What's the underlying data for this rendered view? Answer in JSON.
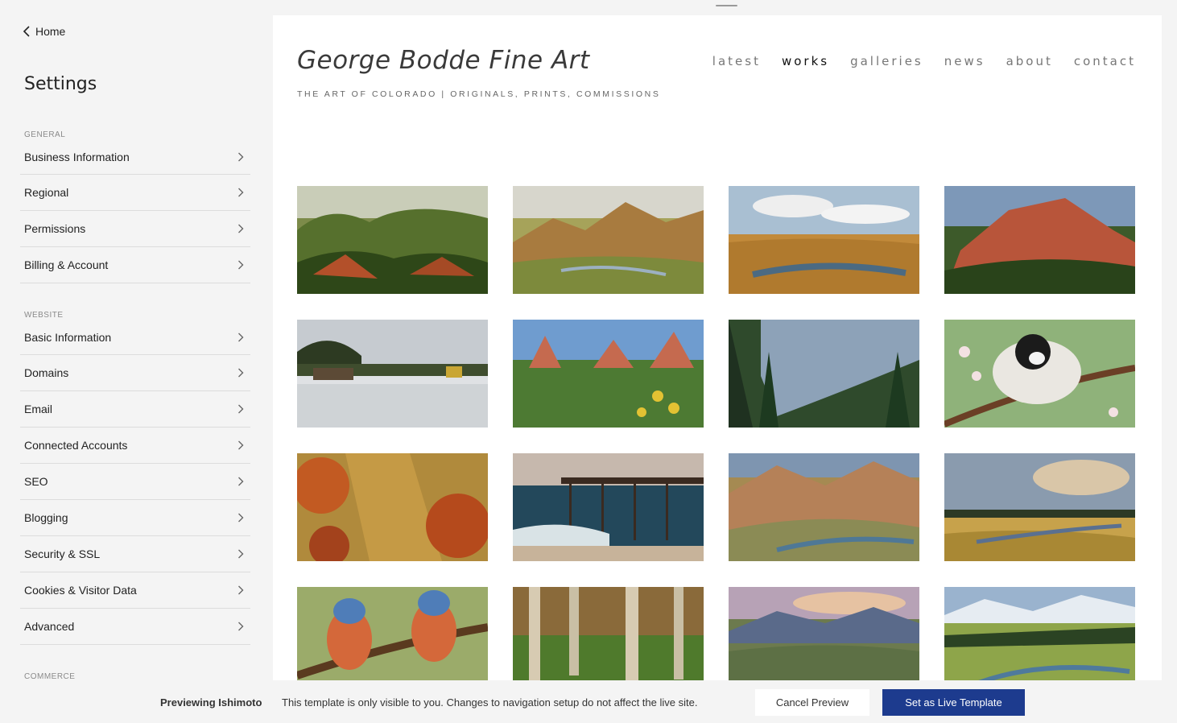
{
  "sidebar": {
    "back_label": "Home",
    "title": "Settings",
    "sections": {
      "general": {
        "label": "GENERAL",
        "items": [
          "Business Information",
          "Regional",
          "Permissions",
          "Billing & Account"
        ]
      },
      "website": {
        "label": "WEBSITE",
        "items": [
          "Basic Information",
          "Domains",
          "Email",
          "Connected Accounts",
          "SEO",
          "Blogging",
          "Security & SSL",
          "Cookies & Visitor Data",
          "Advanced"
        ]
      },
      "commerce": {
        "label": "COMMERCE"
      }
    }
  },
  "site": {
    "title": "George Bodde Fine Art",
    "tagline": "THE ART OF COLORADO | ORIGINALS, PRINTS, COMMISSIONS",
    "nav": [
      "latest",
      "works",
      "galleries",
      "news",
      "about",
      "contact"
    ],
    "active_nav": "works"
  },
  "preview_bar": {
    "name": "Previewing Ishimoto",
    "message": "This template is only visible to you. Changes to navigation setup do not affect the live site.",
    "cancel_label": "Cancel Preview",
    "live_label": "Set as Live Template"
  },
  "colors": {
    "accent": "#1d3b8e",
    "sidebar_bg": "#f4f4f4"
  }
}
